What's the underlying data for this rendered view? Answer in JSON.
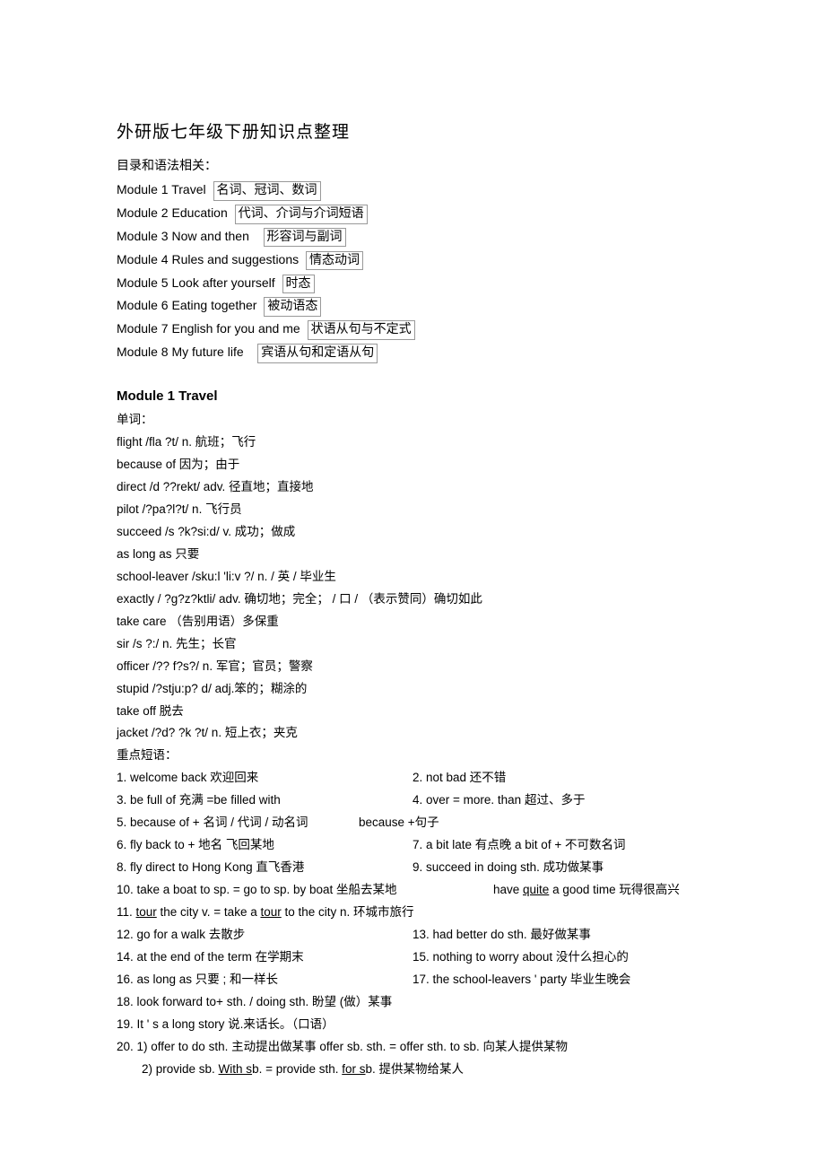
{
  "title": "外研版七年级下册知识点整理",
  "tocHeader": "目录和语法相关：",
  "toc": [
    {
      "module": "Module 1 Travel",
      "grammar": "名词、冠词、数词"
    },
    {
      "module": "Module 2 Education",
      "grammar": "代词、介词与介词短语"
    },
    {
      "module": "Module 3 Now and then",
      "grammar": "形容词与副词"
    },
    {
      "module": "Module 4 Rules and suggestions",
      "grammar": "情态动词"
    },
    {
      "module": "Module 5 Look after yourself",
      "grammar": "时态"
    },
    {
      "module": "Module 6 Eating together",
      "grammar": "被动语态"
    },
    {
      "module": "Module 7 English for you and me",
      "grammar": "状语从句与不定式"
    },
    {
      "module": "Module 8 My future life",
      "grammar": "宾语从句和定语从句"
    }
  ],
  "module1": {
    "heading": "Module 1 Travel",
    "vocabLabel": "单词：",
    "vocab": [
      "flight /fla ?t/  n. 航班；飞行",
      "because of  因为；由于",
      "direct /d ??rekt/  adv. 径直地；直接地",
      "pilot /?pa?l?t/   n. 飞行员",
      "succeed /s ?k?si:d/ v. 成功；做成",
      "as long as 只要",
      "school-leaver /sku:l 'li:v    ?/ n. / 英 / 毕业生",
      "exactly / ?g?z?ktli/ adv.  确切地；完全；      / 口 / （表示赞同）确切如此",
      "take care  （告别用语）多保重",
      "sir /s ?:/  n. 先生；长官",
      "officer /?? f?s?/ n.  军官；官员；警察",
      "stupid /?stju:p? d/  adj.笨的；糊涂的",
      "take off   脱去",
      "jacket /?d? ?k ?t/  n. 短上衣；夹克"
    ],
    "phrasesLabel": "重点短语：",
    "phrases": {
      "r1a": "1. welcome back     欢迎回来",
      "r1b": "2. not bad    还不错",
      "r2a": "3. be full of     充满 =be filled with",
      "r2b": "4. over = more. than   超过、多于",
      "r3a": "5. because of + 名词 /    代词 / 动名词",
      "r3b": "because +句子",
      "r4a": "6. fly back to + 地名      飞回某地",
      "r4b": "7. a bit late    有点晚      a bit of +  不可数名词",
      "r5a": "8. fly direct to Hong Kong      直飞香港",
      "r5b": "9. succeed in doing sth.    成功做某事",
      "r6a": "10. take a boat to sp. = go to sp. by boat   坐船去某地",
      "r6b": "have quite a good time    玩得很高兴",
      "r7": "11. tour the city     v.  = take a tour to the city   n. 环城市旅行",
      "r8a": "12. go for a walk   去散步",
      "r8b": "13. had better do sth. 最好做某事",
      "r9a": "14. at the end of the term   在学期末",
      "r9b": "15. nothing to worry about   没什么担心的",
      "r10a": "16. as long as  只要 ; 和一样长",
      "r10b": "17. the school-leavers   ' party 毕业生晚会",
      "r11": "18. look forward to+ sth. / doing sth.    盼望 (做）某事",
      "r12": "19.    It  ' s a long story 说.来话长。（口语）",
      "r13": "20. 1) offer to do sth.   主动提出做某事 offer sb. sth. = offer sth. to sb.  向某人提供某物",
      "r14": "2) provide sb. With sb. = provide sth. for sb.   提供某物给某人"
    }
  }
}
